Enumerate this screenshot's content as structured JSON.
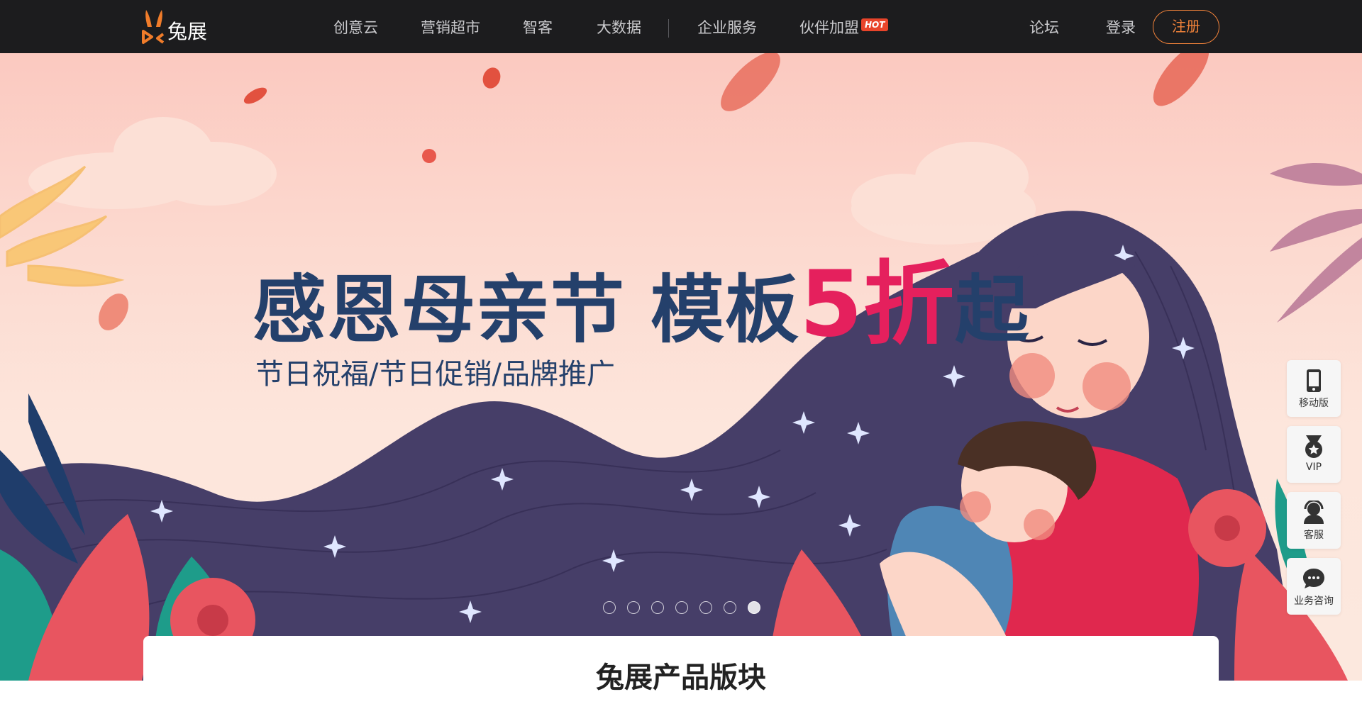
{
  "brand": {
    "name": "兔展",
    "logo_color": "#f07c2a"
  },
  "nav": {
    "items": [
      {
        "label": "创意云"
      },
      {
        "label": "营销超市"
      },
      {
        "label": "智客"
      },
      {
        "label": "大数据"
      },
      {
        "label": "企业服务"
      },
      {
        "label": "伙伴加盟",
        "badge": "HOT"
      }
    ],
    "forum": "论坛",
    "login": "登录",
    "register": "注册"
  },
  "hero": {
    "title_part1": "感恩母亲节",
    "title_part2": "模板",
    "title_accent": "5折",
    "title_part3": "起",
    "subtitle": "节日祝福/节日促销/品牌推广",
    "slide_count": 7,
    "active_slide": 7
  },
  "sidebar": [
    {
      "label": "移动版",
      "icon": "mobile-icon"
    },
    {
      "label": "VIP",
      "icon": "vip-medal-icon"
    },
    {
      "label": "客服",
      "icon": "customer-service-icon"
    },
    {
      "label": "业务咨询",
      "icon": "chat-bubble-icon"
    }
  ],
  "content": {
    "section_title": "兔展产品版块"
  },
  "colors": {
    "nav_bg": "#1c1c1e",
    "accent_orange": "#f0823a",
    "hot_badge": "#e8442a",
    "title_navy": "#24406b",
    "title_pink": "#e5205d"
  }
}
